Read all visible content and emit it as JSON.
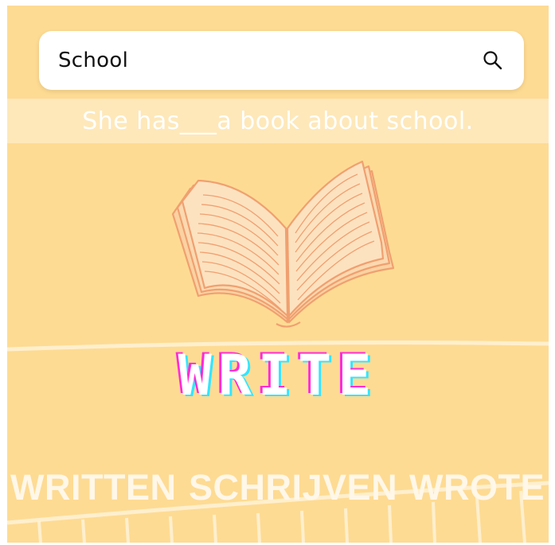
{
  "search": {
    "value": "School",
    "icon": "search-icon"
  },
  "exercise": {
    "sentence": "She has___a book about school."
  },
  "illustration": {
    "icon": "open-book-icon"
  },
  "verb": {
    "headword": "WRITE"
  },
  "forms": {
    "first": "WRITTEN",
    "second": "SCHRIJVEN",
    "third": "WROTE"
  },
  "colors": {
    "background": "#fedb93",
    "book_stroke": "#f0a070",
    "book_fill": "#fcd9b0",
    "glitch_magenta": "#ff2bd6",
    "glitch_cyan": "#33e6ff"
  }
}
